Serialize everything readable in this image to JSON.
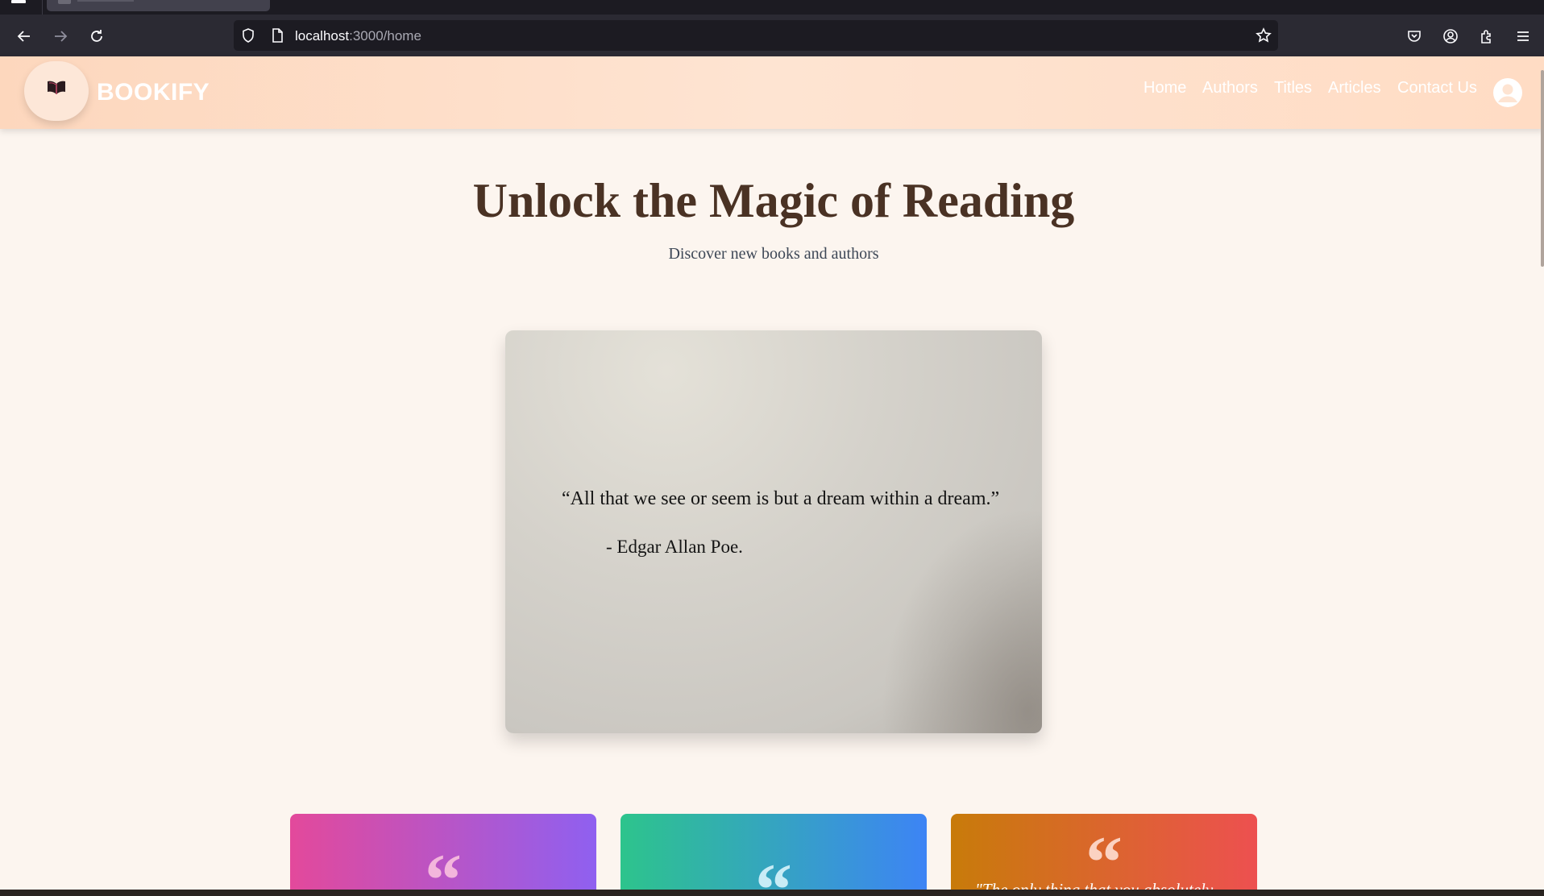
{
  "browser": {
    "url_host": "localhost",
    "url_path": ":3000/home"
  },
  "site": {
    "brand": "BOOKIFY",
    "nav": [
      "Home",
      "Authors",
      "Titles",
      "Articles",
      "Contact Us"
    ]
  },
  "hero": {
    "title": "Unlock the Magic of Reading",
    "subtitle": "Discover new books and authors"
  },
  "featured_quote": {
    "text": "“All that we see or seem is but a dream within a dream.”",
    "author": "-  Edgar Allan Poe."
  },
  "quote_cards": [
    {
      "snippet": ""
    },
    {
      "snippet": ""
    },
    {
      "snippet": "\"The only thing that you absolutely"
    }
  ],
  "colors": {
    "heading": "#4a3224",
    "navbar_bg": "#fee4d2",
    "page_bg": "#fcf5ef"
  }
}
